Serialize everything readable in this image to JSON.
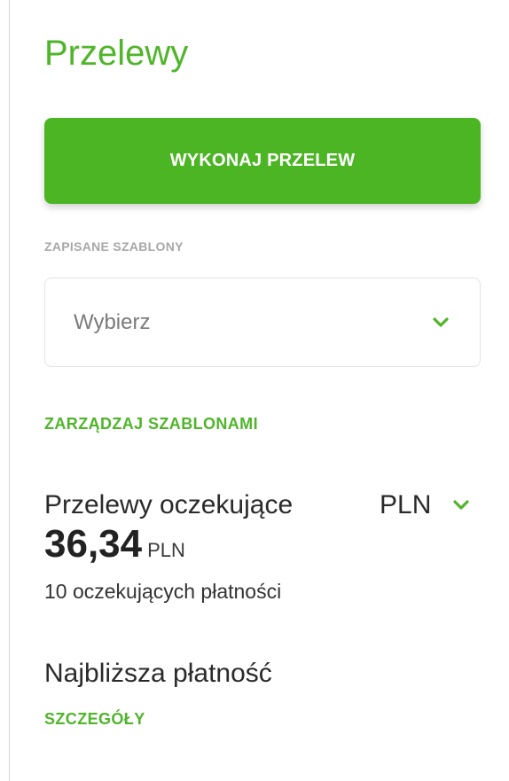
{
  "panel": {
    "title": "Przelewy",
    "primary_button_label": "WYKONAJ PRZELEW",
    "templates": {
      "section_label": "ZAPISANE SZABLONY",
      "selected_value": "Wybierz",
      "manage_link": "ZARZĄDZAJ SZABLONAMI"
    },
    "pending": {
      "label": "Przelewy oczekujące",
      "currency_selected": "PLN",
      "amount": "36,34",
      "amount_currency": "PLN",
      "count_text": "10 oczekujących płatności"
    },
    "next_payment": {
      "label": "Najbliższa płatność",
      "details_link": "SZCZEGÓŁY"
    }
  },
  "icons": {
    "template_select_chevron": "chevron-down-icon",
    "currency_chevron": "chevron-down-icon"
  },
  "colors": {
    "accent": "#4fb529",
    "button_bg": "#4cb523",
    "muted_label": "#a7a7a7",
    "text_dark": "#2a2a2a"
  }
}
